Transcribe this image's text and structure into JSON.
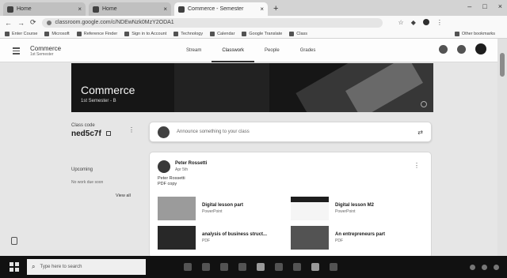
{
  "browser": {
    "tabs": [
      {
        "title": "Home",
        "active": false
      },
      {
        "title": "Home",
        "active": false
      },
      {
        "title": "Commerce - Semester",
        "active": true
      }
    ],
    "url": "classroom.google.com/c/NDEwNzk0MzY2ODA1",
    "bookmarks": [
      "Enter Course",
      "Microsoft",
      "Reference Finder",
      "Sign in to Account",
      "Technology",
      "Calendar",
      "Google Translate",
      "Class",
      "Other bookmarks"
    ]
  },
  "classroom": {
    "course_name": "Commerce",
    "course_sub": "1st Semester",
    "tabs": [
      "Stream",
      "Classwork",
      "People",
      "Grades"
    ],
    "active_tab": "Stream"
  },
  "banner": {
    "title": "Commerce",
    "subtitle": "1st Semester - B"
  },
  "sidebar": {
    "class_code_label": "Class code",
    "class_code": "ned5c7f",
    "upcoming_label": "Upcoming",
    "upcoming_text": "No work due soon",
    "view_all": "View all"
  },
  "announce": {
    "placeholder": "Announce something to your class"
  },
  "post": {
    "author": "Peter Rossetti",
    "date": "Apr 5th",
    "text_line1": "Peter Rossetti",
    "text_line2": "PDF copy",
    "attachments": [
      {
        "name": "Digital lesson part",
        "type": "PowerPoint"
      },
      {
        "name": "Digital lesson M2",
        "type": "PowerPoint"
      },
      {
        "name": "analysis of business struct...",
        "type": "PDF"
      },
      {
        "name": "An entrepreneurs part",
        "type": "PDF"
      }
    ]
  },
  "taskbar": {
    "search_placeholder": "Type here to search"
  }
}
